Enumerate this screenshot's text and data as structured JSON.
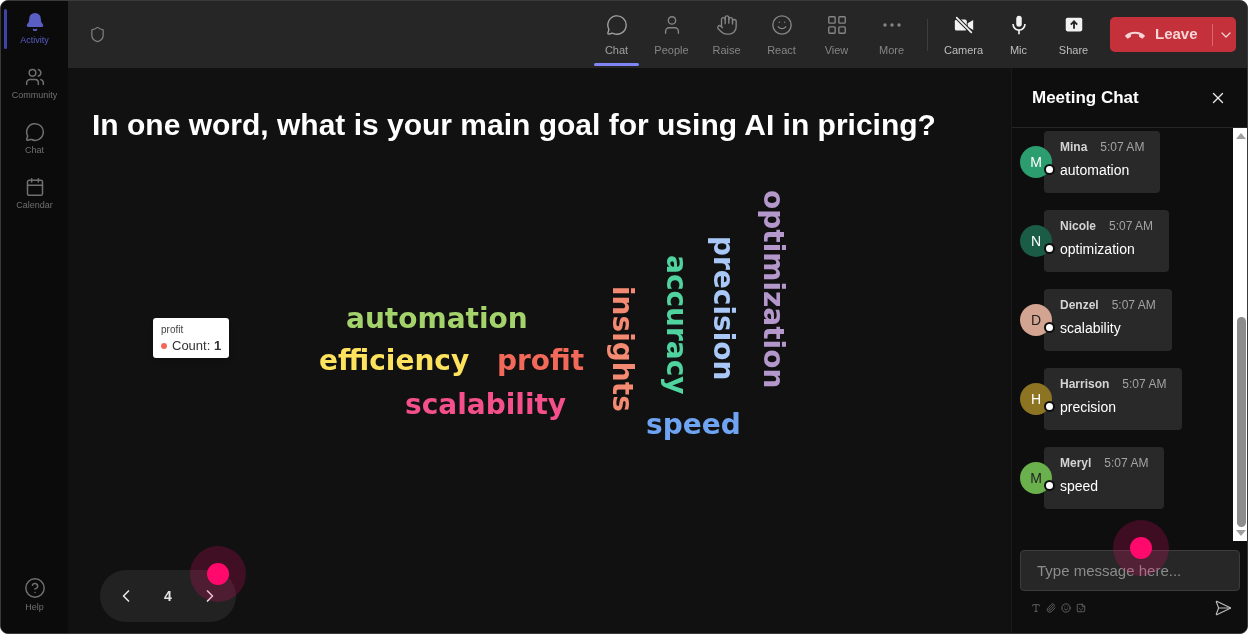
{
  "sidebar": {
    "items": [
      {
        "label": "Activity",
        "selected": true
      },
      {
        "label": "Community",
        "selected": false
      },
      {
        "label": "Chat",
        "selected": false
      },
      {
        "label": "Calendar",
        "selected": false
      }
    ],
    "help": {
      "label": "Help"
    }
  },
  "toolbar": {
    "buttons": [
      {
        "label": "Chat",
        "selected": true
      },
      {
        "label": "People",
        "selected": false
      },
      {
        "label": "Raise",
        "selected": false
      },
      {
        "label": "React",
        "selected": false
      },
      {
        "label": "View",
        "selected": false
      },
      {
        "label": "More",
        "selected": false
      }
    ],
    "devices": [
      {
        "label": "Camera",
        "on": false
      },
      {
        "label": "Mic",
        "on": true
      },
      {
        "label": "Share"
      }
    ],
    "leave": {
      "label": "Leave"
    }
  },
  "slide": {
    "question": "In one word, what is your main goal for using AI in pricing?",
    "word_cloud": {
      "words": [
        {
          "text": "optimization",
          "color": "#b497cb",
          "kind": "vertical"
        },
        {
          "text": "precision",
          "color": "#a9c7f7",
          "kind": "vertical"
        },
        {
          "text": "accuracy",
          "color": "#4fd39f",
          "kind": "vertical"
        },
        {
          "text": "insights",
          "color": "#f58a73",
          "kind": "vertical"
        },
        {
          "text": "automation",
          "color": "#a5d36b",
          "kind": "horizontal"
        },
        {
          "text": "efficiency",
          "color": "#fde35d",
          "kind": "horizontal"
        },
        {
          "text": "profit",
          "color": "#f2695a",
          "kind": "horizontal"
        },
        {
          "text": "scalability",
          "color": "#f5508b",
          "kind": "horizontal"
        },
        {
          "text": "speed",
          "color": "#6ea4f2",
          "kind": "horizontal"
        }
      ]
    },
    "tooltip": {
      "title": "profit",
      "color": "#f2695a",
      "text": "Count: **1**"
    },
    "page": "4"
  },
  "chat": {
    "title": "Meeting Chat",
    "messages": [
      {
        "name": "Mina",
        "initial": "M",
        "color": "#2c9d6e",
        "time": "5:07 AM",
        "text": "automation"
      },
      {
        "name": "Nicole",
        "initial": "N",
        "color": "#1a5c45",
        "time": "5:07 AM",
        "text": "optimization"
      },
      {
        "name": "Denzel",
        "initial": "D",
        "color": "#d4a493",
        "time": "5:07 AM",
        "text": "scalability"
      },
      {
        "name": "Harrison",
        "initial": "H",
        "color": "#8c7423",
        "time": "5:07 AM",
        "text": "precision"
      },
      {
        "name": "Meryl",
        "initial": "M",
        "color": "#6ab04c",
        "time": "5:07 AM",
        "text": "speed"
      }
    ],
    "input": {
      "placeholder": "Type message here..."
    }
  }
}
